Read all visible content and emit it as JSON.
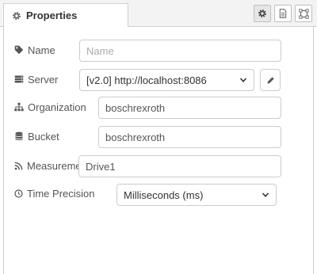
{
  "tabs": {
    "properties_label": "Properties"
  },
  "toolbar": {
    "settings_icon": "gear-icon",
    "description_icon": "document-icon",
    "appearance_icon": "frame-icon"
  },
  "form": {
    "name": {
      "label": "Name",
      "placeholder": "Name",
      "value": ""
    },
    "server": {
      "label": "Server",
      "value": "[v2.0] http://localhost:8086"
    },
    "organization": {
      "label": "Organization",
      "value": "boschrexroth"
    },
    "bucket": {
      "label": "Bucket",
      "value": "boschrexroth"
    },
    "measurement": {
      "label": "Measurement",
      "value": "Drive1"
    },
    "time_precision": {
      "label": "Time Precision",
      "value": "Milliseconds (ms)"
    }
  }
}
